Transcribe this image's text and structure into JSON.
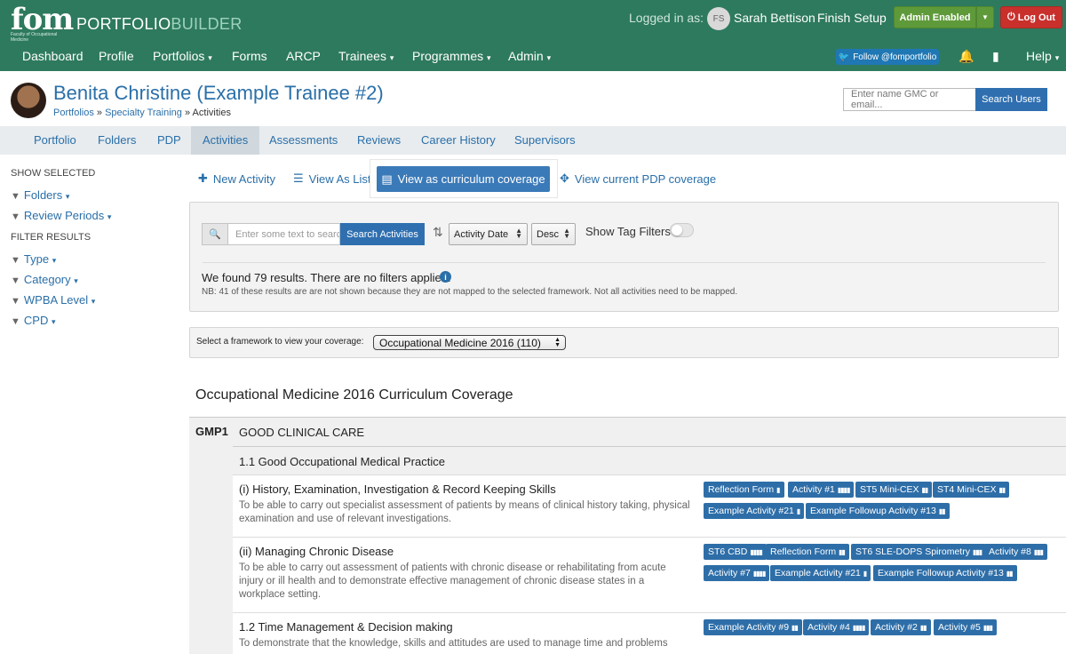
{
  "header": {
    "logo_text": "fom",
    "logo_sub": "Faculty of Occupational Medicine",
    "brand_part1": "PORTFOLIO",
    "brand_part2": "BUILDER",
    "logged_in_label": "Logged in as:",
    "user_initials": "FS",
    "user_name": "Sarah Bettison",
    "finish_setup": "Finish Setup",
    "admin_label": "Admin Enabled",
    "logout_label": "Log Out"
  },
  "nav": {
    "items": [
      "Dashboard",
      "Profile",
      "Portfolios",
      "Forms",
      "ARCP",
      "Trainees",
      "Programmes",
      "Admin"
    ],
    "follow_label": "Follow @fomportfolio",
    "help_label": "Help"
  },
  "trainee": {
    "name": "Benita Christine (Example Trainee #2)",
    "breadcrumb_1": "Portfolios",
    "breadcrumb_sep": " » ",
    "breadcrumb_2": "Specialty Training",
    "breadcrumb_3": "Activities"
  },
  "search_users": {
    "placeholder": "Enter name GMC or email...",
    "button": "Search Users"
  },
  "tabs": [
    "Portfolio",
    "Folders",
    "PDP",
    "Activities",
    "Assessments",
    "Reviews",
    "Career History",
    "Supervisors"
  ],
  "active_tab": "Activities",
  "sidebar": {
    "show_selected": "SHOW SELECTED",
    "filter_results": "FILTER RESULTS",
    "selected_filters": [
      "Folders",
      "Review Periods"
    ],
    "result_filters": [
      "Type",
      "Category",
      "WPBA Level",
      "CPD"
    ]
  },
  "actions": {
    "new_activity": "New Activity",
    "view_list": "View As List",
    "view_curriculum": "View as curriculum coverage",
    "view_pdp": "View current PDP coverage"
  },
  "search": {
    "placeholder": "Enter some text to search",
    "button": "Search Activities",
    "sort_field": "Activity Date",
    "sort_order": "Desc",
    "tag_filters": "Show Tag Filters",
    "results": "We found 79 results. There are no filters applied.",
    "note": "NB: 41 of these results are are not shown because they are not mapped to the selected framework. Not all activities need to be mapped."
  },
  "framework": {
    "label": "Select a framework to view your coverage:",
    "selected": "Occupational Medicine 2016 (110)"
  },
  "coverage": {
    "title": "Occupational Medicine 2016 Curriculum Coverage",
    "gmp_code": "GMP1",
    "gmp_title": "GOOD CLINICAL CARE",
    "section_1_1": "1.1 Good Occupational Medical Practice",
    "item_1_title": "(i) History, Examination, Investigation & Record Keeping Skills",
    "item_1_desc": "To be able to carry out specialist assessment of patients by means of clinical history taking, physical examination and use of relevant investigations.",
    "item_1_badges": [
      "Reflection Form",
      "Activity #1",
      "ST5 Mini-CEX",
      "ST4 Mini-CEX",
      "Example Activity #21",
      "Example Followup Activity #13"
    ],
    "item_2_title": "(ii) Managing Chronic Disease",
    "item_2_desc": "To be able to carry out assessment of patients with chronic disease or rehabilitating from acute injury or ill health and to demonstrate effective management of chronic disease states in a workplace setting.",
    "item_2_badges": [
      "ST6 CBD",
      "Reflection Form",
      "ST6 SLE-DOPS Spirometry",
      "Activity #8",
      "Activity #7",
      "Example Activity #21",
      "Example Followup Activity #13"
    ],
    "item_3_title": "1.2 Time Management & Decision making",
    "item_3_desc": "To demonstrate that the knowledge, skills and attitudes are used to manage time and problems",
    "item_3_badges": [
      "Example Activity #9",
      "Activity #4",
      "Activity #2",
      "Activity #5"
    ]
  },
  "colors": {
    "header_green": "#2e7a5e",
    "link_blue": "#2a6fa8",
    "badge_blue": "#2e6ea8",
    "admin_green": "#5f9a3a",
    "logout_red": "#c9302c"
  }
}
